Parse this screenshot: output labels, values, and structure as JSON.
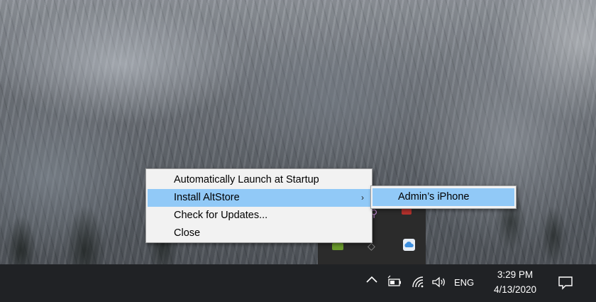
{
  "context_menu": {
    "items": [
      {
        "label": "Automatically Launch at Startup",
        "has_submenu": false,
        "highlighted": false
      },
      {
        "label": "Install AltStore",
        "has_submenu": true,
        "highlighted": true
      },
      {
        "label": "Check for Updates...",
        "has_submenu": false,
        "highlighted": false
      },
      {
        "label": "Close",
        "has_submenu": false,
        "highlighted": false
      }
    ],
    "submenu_arrow": "›"
  },
  "submenu": {
    "items": [
      {
        "label": "Admin’s iPhone",
        "highlighted": true
      }
    ]
  },
  "taskbar": {
    "show_hidden_icons": "^",
    "language": "ENG",
    "time": "3:29 PM",
    "date": "4/13/2020",
    "icons": [
      "chevron-up-icon",
      "battery-icon",
      "wifi-icon",
      "volume-icon",
      "notification-icon"
    ]
  },
  "tray_overflow": {
    "icons": [
      "altstore-icon",
      "nvidia-icon",
      "red-app-icon",
      "usb-icon",
      "icloud-icon"
    ]
  },
  "colors": {
    "menu_bg": "#f2f2f2",
    "highlight": "#91c9f7",
    "taskbar_bg": "#202225"
  }
}
